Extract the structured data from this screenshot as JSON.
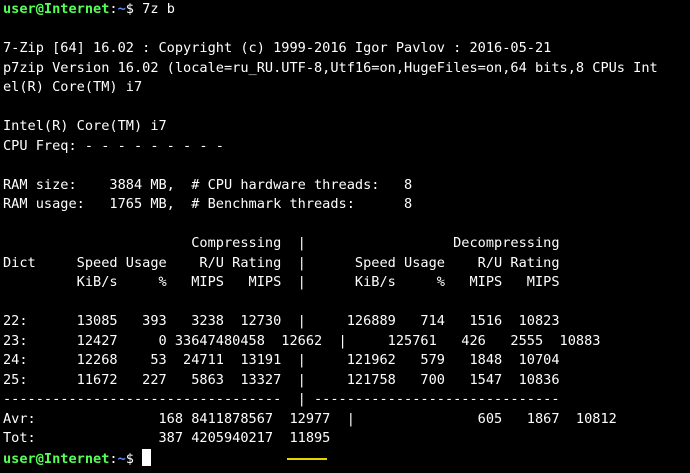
{
  "prompt": {
    "user_host": "user@Internet",
    "separator": ":",
    "path": "~",
    "symbol": "$ "
  },
  "command": "7z b",
  "lines": [
    "",
    "7-Zip [64] 16.02 : Copyright (c) 1999-2016 Igor Pavlov : 2016-05-21",
    "p7zip Version 16.02 (locale=ru_RU.UTF-8,Utf16=on,HugeFiles=on,64 bits,8 CPUs Int",
    "el(R) Core(TM) i7",
    "",
    "Intel(R) Core(TM) i7",
    "CPU Freq: - - - - - - - - -",
    "",
    "RAM size:    3884 MB,  # CPU hardware threads:   8",
    "RAM usage:   1765 MB,  # Benchmark threads:      8",
    "",
    "                       Compressing  |                  Decompressing",
    "Dict     Speed Usage    R/U Rating  |      Speed Usage    R/U Rating",
    "         KiB/s     %   MIPS   MIPS  |      KiB/s     %   MIPS   MIPS",
    "",
    "22:      13085   393   3238  12730  |     126889   714   1516  10823",
    "23:      12427     0 33647480458  12662  |     125761   426   2555  10883",
    "24:      12268    53  24711  13191  |     121962   579   1848  10704",
    "25:      11672   227   5863  13327  |     121758   700   1547  10836",
    "----------------------------------  | ------------------------------",
    "Avr:               168 8411878567  12977  |               605   1867  10812",
    "Tot:               387 4205940217  11895"
  ],
  "highlight_color": "#e6d400"
}
